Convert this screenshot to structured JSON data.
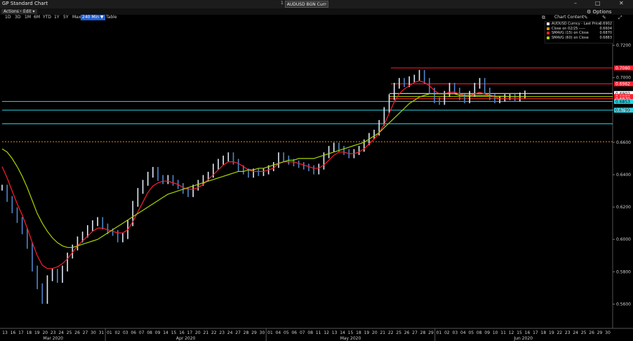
{
  "window": {
    "title": "GP Standard Chart",
    "security_prefix": "1",
    "security": "AUDUSD BGN Curncy",
    "options_label": "Options"
  },
  "actions": {
    "actions_label": "Actions",
    "edit_label": "Edit"
  },
  "ranges": [
    {
      "label": "1D",
      "active": false
    },
    {
      "label": "3D",
      "active": false
    },
    {
      "label": "1M",
      "active": false
    },
    {
      "label": "6M",
      "active": false
    },
    {
      "label": "YTD",
      "active": false
    },
    {
      "label": "1Y",
      "active": false
    },
    {
      "label": "5Y",
      "active": false
    },
    {
      "label": "Max",
      "active": false
    },
    {
      "label": "240 Min ▼",
      "active": true
    },
    {
      "label": "Table",
      "active": false
    }
  ],
  "chart_content_label": "Chart Content",
  "colors": {
    "price": "#a9c6ea",
    "sma15": "#ff1e2d",
    "sma60": "#a8d400",
    "cyan": "#29d8e8",
    "red_line": "#ff1e2d",
    "orange": "#e88a1a",
    "white": "#ffffff"
  },
  "chart_data": {
    "type": "line",
    "ylim": [
      0.545,
      0.735
    ],
    "yticks": [
      "0.5600",
      "0.5800",
      "0.6000",
      "0.6200",
      "0.6400",
      "0.6600",
      "0.6800",
      "0.7000",
      "0.7200"
    ],
    "xticks": [
      "13",
      "16",
      "17",
      "18",
      "19",
      "20",
      "23",
      "24",
      "25",
      "26",
      "27",
      "30",
      "31",
      "01",
      "02",
      "03",
      "06",
      "07",
      "08",
      "09",
      "14",
      "15",
      "16",
      "17",
      "20",
      "21",
      "22",
      "23",
      "24",
      "27",
      "28",
      "29",
      "30",
      "01",
      "04",
      "05",
      "06",
      "07",
      "08",
      "11",
      "12",
      "13",
      "14",
      "15",
      "18",
      "19",
      "20",
      "21",
      "22",
      "25",
      "26",
      "27",
      "28",
      "29",
      "01",
      "02",
      "03",
      "04",
      "05",
      "08",
      "09",
      "10",
      "11",
      "12",
      "15",
      "16",
      "17",
      "18",
      "19",
      "22",
      "23",
      "24",
      "25",
      "26",
      "29",
      "30"
    ],
    "months": [
      "Mar 2020",
      "Apr 2020",
      "May 2020",
      "Jun 2020"
    ],
    "legend": [
      {
        "name": "AUDUSD Curncy - Last Price",
        "value": "0.6902",
        "color": "#ffffff"
      },
      {
        "name": "Close on 02/25 -----",
        "value": "0.6604",
        "color": "#e88a1a"
      },
      {
        "name": "SMAVG (15) on Close",
        "value": "0.6870",
        "color": "#ff1e2d"
      },
      {
        "name": "SMAVG (60) on Close",
        "value": "0.6883",
        "color": "#a8d400"
      }
    ],
    "hlines": [
      {
        "y": 0.706,
        "color": "#ff1e2d",
        "label": "0.7060",
        "tag_bg": "#ff1e2d",
        "tag_fg": "#ffffff"
      },
      {
        "y": 0.6962,
        "color": "#ff1e2d",
        "label": "0.6962",
        "tag_bg": "#ff1e2d",
        "tag_fg": "#ffffff"
      },
      {
        "y": 0.6902,
        "color": "#ffffff",
        "label": "0.6902",
        "tag_bg": "#ffffff",
        "tag_fg": "#000000"
      },
      {
        "y": 0.6883,
        "color": "#a8d400",
        "label": "0.6883",
        "tag_bg": "#ff1e2d",
        "tag_fg": "#ffffff"
      },
      {
        "y": 0.687,
        "color": "#ff1e2d",
        "label": "0.6870",
        "tag_bg": "#ff1e2d",
        "tag_fg": "#ffffff"
      },
      {
        "y": 0.6853,
        "color": "#29d8e8",
        "label": "0.6853",
        "tag_bg": "#29d8e8",
        "tag_fg": "#000000"
      },
      {
        "y": 0.6799,
        "color": "#29d8e8",
        "label": "0.6799",
        "tag_bg": "#29d8e8",
        "tag_fg": "#000000"
      },
      {
        "y": 0.6715,
        "color": "#29d8e8",
        "label": "",
        "tag_bg": "",
        "tag_fg": ""
      },
      {
        "y": 0.6604,
        "color": "#e88a1a",
        "label": "",
        "tag_bg": "",
        "tag_fg": "",
        "dashed": true
      }
    ],
    "series": [
      {
        "name": "AUDUSD Curncy - Last Price",
        "values": [
          0.632,
          0.625,
          0.618,
          0.612,
          0.605,
          0.596,
          0.582,
          0.571,
          0.562,
          0.576,
          0.58,
          0.575,
          0.582,
          0.59,
          0.595,
          0.6,
          0.603,
          0.607,
          0.61,
          0.612,
          0.608,
          0.605,
          0.604,
          0.6,
          0.602,
          0.61,
          0.622,
          0.63,
          0.635,
          0.64,
          0.643,
          0.638,
          0.636,
          0.638,
          0.635,
          0.633,
          0.63,
          0.628,
          0.632,
          0.635,
          0.638,
          0.64,
          0.645,
          0.648,
          0.65,
          0.652,
          0.648,
          0.644,
          0.642,
          0.64,
          0.642,
          0.641,
          0.642,
          0.644,
          0.646,
          0.652,
          0.65,
          0.648,
          0.647,
          0.646,
          0.645,
          0.644,
          0.642,
          0.645,
          0.652,
          0.656,
          0.658,
          0.656,
          0.654,
          0.652,
          0.654,
          0.656,
          0.66,
          0.664,
          0.666,
          0.672,
          0.68,
          0.688,
          0.695,
          0.698,
          0.696,
          0.699,
          0.7,
          0.703,
          0.698,
          0.692,
          0.686,
          0.685,
          0.69,
          0.695,
          0.692,
          0.688,
          0.686,
          0.69,
          0.695,
          0.698,
          0.692,
          0.688,
          0.686,
          0.687,
          0.688,
          0.688,
          0.687,
          0.689,
          0.6902
        ]
      },
      {
        "name": "SMAVG (15) on Close",
        "values": [
          0.645,
          0.638,
          0.63,
          0.622,
          0.615,
          0.607,
          0.598,
          0.59,
          0.584,
          0.582,
          0.582,
          0.583,
          0.585,
          0.588,
          0.592,
          0.596,
          0.599,
          0.602,
          0.605,
          0.607,
          0.607,
          0.606,
          0.605,
          0.604,
          0.604,
          0.606,
          0.611,
          0.617,
          0.623,
          0.629,
          0.633,
          0.635,
          0.636,
          0.636,
          0.635,
          0.634,
          0.632,
          0.631,
          0.631,
          0.632,
          0.634,
          0.637,
          0.64,
          0.643,
          0.646,
          0.648,
          0.648,
          0.647,
          0.645,
          0.643,
          0.642,
          0.642,
          0.642,
          0.643,
          0.644,
          0.647,
          0.648,
          0.648,
          0.648,
          0.647,
          0.646,
          0.645,
          0.644,
          0.644,
          0.646,
          0.649,
          0.652,
          0.654,
          0.654,
          0.653,
          0.653,
          0.654,
          0.656,
          0.659,
          0.662,
          0.666,
          0.671,
          0.678,
          0.685,
          0.69,
          0.693,
          0.695,
          0.697,
          0.698,
          0.697,
          0.695,
          0.692,
          0.69,
          0.69,
          0.691,
          0.691,
          0.69,
          0.689,
          0.689,
          0.69,
          0.691,
          0.69,
          0.689,
          0.688,
          0.687,
          0.687,
          0.687,
          0.687,
          0.687,
          0.687
        ]
      },
      {
        "name": "SMAVG (60) on Close",
        "values": [
          0.656,
          0.654,
          0.65,
          0.645,
          0.639,
          0.632,
          0.624,
          0.616,
          0.61,
          0.605,
          0.601,
          0.598,
          0.596,
          0.595,
          0.595,
          0.596,
          0.597,
          0.598,
          0.599,
          0.6,
          0.602,
          0.604,
          0.606,
          0.608,
          0.61,
          0.612,
          0.614,
          0.616,
          0.618,
          0.62,
          0.622,
          0.624,
          0.626,
          0.628,
          0.629,
          0.63,
          0.631,
          0.632,
          0.633,
          0.634,
          0.635,
          0.636,
          0.637,
          0.638,
          0.639,
          0.64,
          0.641,
          0.642,
          0.642,
          0.643,
          0.643,
          0.644,
          0.644,
          0.645,
          0.646,
          0.647,
          0.648,
          0.649,
          0.649,
          0.65,
          0.65,
          0.65,
          0.65,
          0.651,
          0.652,
          0.653,
          0.654,
          0.655,
          0.656,
          0.657,
          0.658,
          0.659,
          0.66,
          0.662,
          0.664,
          0.666,
          0.669,
          0.672,
          0.675,
          0.678,
          0.681,
          0.684,
          0.686,
          0.688,
          0.689,
          0.69,
          0.69,
          0.69,
          0.69,
          0.69,
          0.69,
          0.689,
          0.689,
          0.689,
          0.689,
          0.689,
          0.689,
          0.689,
          0.6885,
          0.6885,
          0.6885,
          0.6883,
          0.6883,
          0.6883,
          0.6883
        ]
      }
    ]
  }
}
